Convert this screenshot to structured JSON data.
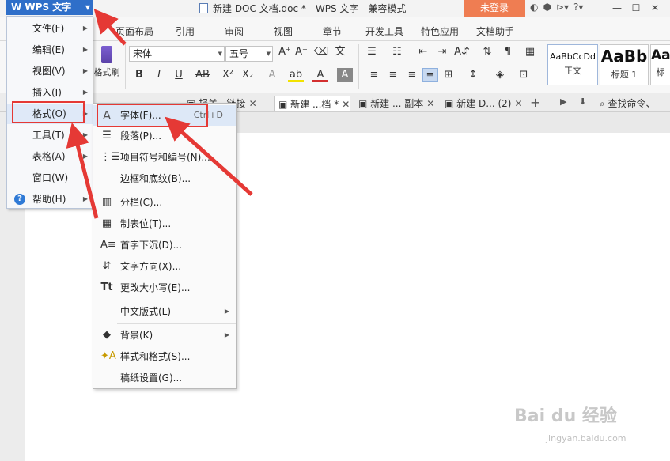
{
  "app": {
    "name": "WPS 文字",
    "title": "新建 DOC 文档.doc * - WPS 文字 - 兼容模式",
    "login": "未登录"
  },
  "window_controls": [
    "—",
    "☐",
    "✕"
  ],
  "menu_tabs": [
    "页面布局",
    "引用",
    "审阅",
    "视图",
    "章节",
    "开发工具",
    "特色应用",
    "文档助手"
  ],
  "toolbar": {
    "format_painter": "格式刷",
    "font_name": "宋体",
    "font_size": "五号",
    "styles": [
      {
        "sample": "AaBbCcDd",
        "name": "正文"
      },
      {
        "sample": "AaBb",
        "name": "标题 1"
      },
      {
        "sample": "Aa",
        "name": "标"
      }
    ]
  },
  "doc_tabs": [
    {
      "label": "报关...链接"
    },
    {
      "label": "新建 ...档 *"
    },
    {
      "label": "新建 ... 副本"
    },
    {
      "label": "新建 D... (2)"
    }
  ],
  "search_command": "查找命令、",
  "wps_menu": [
    {
      "label": "文件(F)"
    },
    {
      "label": "编辑(E)"
    },
    {
      "label": "视图(V)"
    },
    {
      "label": "插入(I)"
    },
    {
      "label": "格式(O)"
    },
    {
      "label": "工具(T)"
    },
    {
      "label": "表格(A)"
    },
    {
      "label": "窗口(W)"
    },
    {
      "label": "帮助(H)"
    }
  ],
  "format_menu": [
    {
      "label": "字体(F)...",
      "shortcut": "Ctrl+D"
    },
    {
      "label": "段落(P)..."
    },
    {
      "label": "项目符号和编号(N)..."
    },
    {
      "label": "边框和底纹(B)..."
    },
    {
      "label": "分栏(C)..."
    },
    {
      "label": "制表位(T)..."
    },
    {
      "label": "首字下沉(D)..."
    },
    {
      "label": "文字方向(X)..."
    },
    {
      "label": "更改大小写(E)..."
    },
    {
      "label": "中文版式(L)"
    },
    {
      "label": "背景(K)"
    },
    {
      "label": "样式和格式(S)..."
    },
    {
      "label": "稿纸设置(G)..."
    }
  ],
  "watermark": {
    "logo": "Bai du 经验",
    "url": "jingyan.baidu.com"
  },
  "colors": {
    "wps_blue": "#2f6fc9",
    "login_orange": "#ef7d52",
    "highlight_red": "#e53935"
  }
}
